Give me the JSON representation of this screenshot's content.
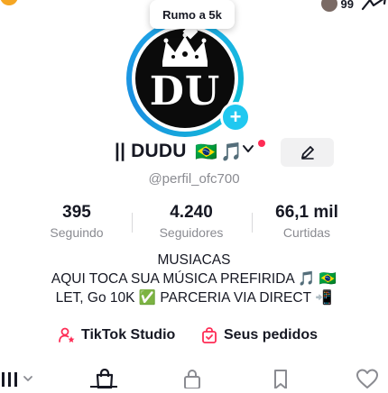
{
  "tooltip": {
    "text": "Rumo a 5k"
  },
  "top_right": {
    "friend_count": "99"
  },
  "avatar": {
    "monogram": "DU"
  },
  "profile": {
    "display_name": "|| DUDU",
    "name_flag": "🇧🇷",
    "name_note": "🎵",
    "handle": "@perfil_ofc700"
  },
  "stats": [
    {
      "value": "395",
      "label": "Seguindo"
    },
    {
      "value": "4.240",
      "label": "Seguidores"
    },
    {
      "value": "66,1 mil",
      "label": "Curtidas"
    }
  ],
  "bio": [
    "MUSIACAS",
    "AQUI TOCA SUA MÚSICA PREFIRIDA 🎵 🇧🇷",
    "LET, Go 10K ✅ PARCERIA VIA DIRECT 📲"
  ],
  "links": {
    "studio_label": "TikTok Studio",
    "orders_label": "Seus pedidos"
  },
  "colors": {
    "ring": "#1ea9e8",
    "plus": "#20c8f0",
    "notify_dot": "#fe2c55",
    "studio_icon": "#fe2c55"
  },
  "tabs": {
    "items": [
      "videos-grid-icon",
      "shop-bag-icon",
      "private-lock-icon",
      "saved-bookmark-icon",
      "liked-heart-icon"
    ],
    "active": "shop-bag-icon"
  }
}
